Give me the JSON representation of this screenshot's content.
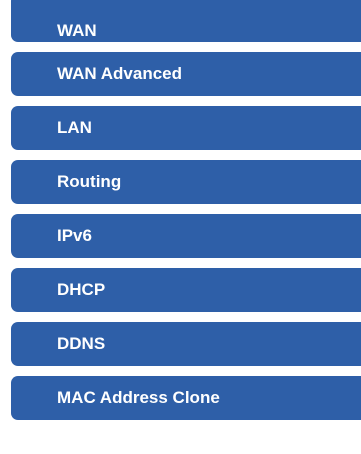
{
  "sidebar": {
    "items": [
      {
        "label": "WAN"
      },
      {
        "label": "WAN Advanced"
      },
      {
        "label": "LAN"
      },
      {
        "label": "Routing"
      },
      {
        "label": "IPv6"
      },
      {
        "label": "DHCP"
      },
      {
        "label": "DDNS"
      },
      {
        "label": "MAC Address Clone"
      }
    ]
  }
}
